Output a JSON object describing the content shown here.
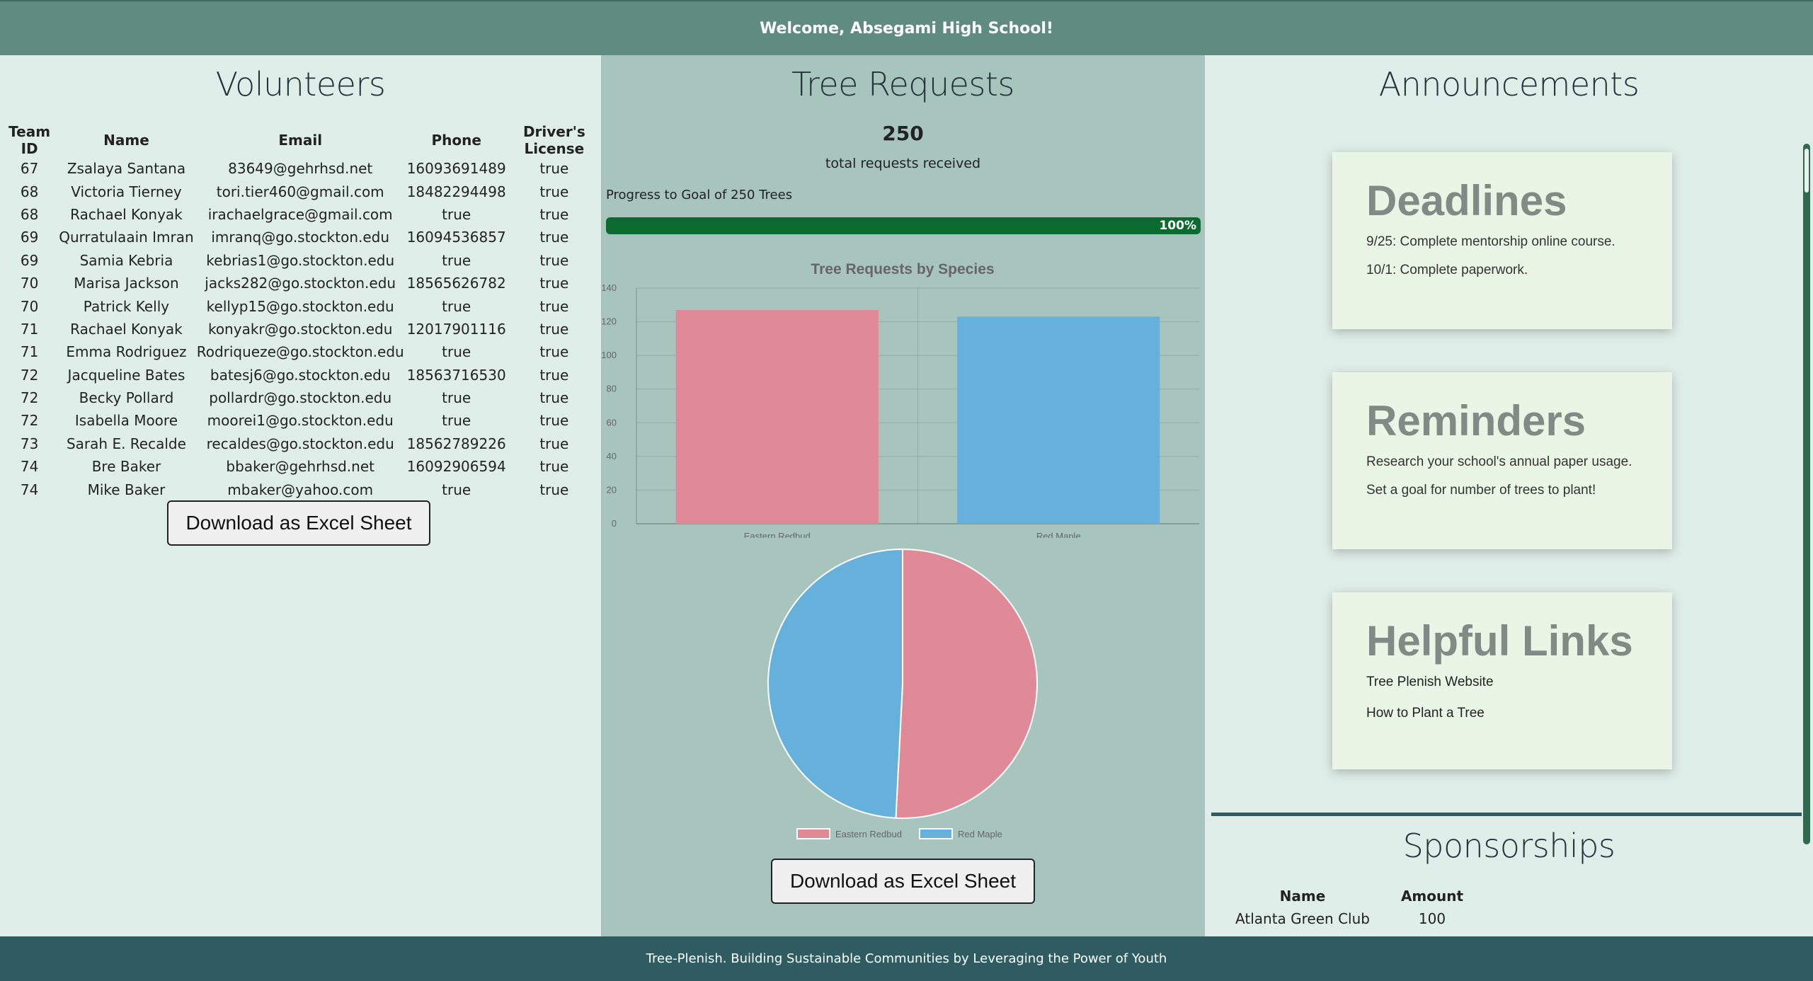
{
  "header": {
    "welcome": "Welcome, Absegami High School!"
  },
  "volunteers": {
    "title": "Volunteers",
    "columns": [
      "Team ID",
      "Name",
      "Email",
      "Phone",
      "Driver's License"
    ],
    "rows": [
      [
        "67",
        "Zsalaya Santana",
        "83649@gehrhsd.net",
        "16093691489",
        "true"
      ],
      [
        "68",
        "Victoria Tierney",
        "tori.tier460@gmail.com",
        "18482294498",
        "true"
      ],
      [
        "68",
        "Rachael Konyak",
        "irachaelgrace@gmail.com",
        "true",
        "true"
      ],
      [
        "69",
        "Qurratulaain Imran",
        "imranq@go.stockton.edu",
        "16094536857",
        "true"
      ],
      [
        "69",
        "Samia Kebria",
        "kebrias1@go.stockton.edu",
        "true",
        "true"
      ],
      [
        "70",
        "Marisa Jackson",
        "jacks282@go.stockton.edu",
        "18565626782",
        "true"
      ],
      [
        "70",
        "Patrick Kelly",
        "kellyp15@go.stockton.edu",
        "true",
        "true"
      ],
      [
        "71",
        "Rachael Konyak",
        "konyakr@go.stockton.edu",
        "12017901116",
        "true"
      ],
      [
        "71",
        "Emma Rodriguez",
        "Rodriqueze@go.stockton.edu",
        "true",
        "true"
      ],
      [
        "72",
        "Jacqueline Bates",
        "batesj6@go.stockton.edu",
        "18563716530",
        "true"
      ],
      [
        "72",
        "Becky Pollard",
        "pollardr@go.stockton.edu",
        "true",
        "true"
      ],
      [
        "72",
        "Isabella Moore",
        "moorei1@go.stockton.edu",
        "true",
        "true"
      ],
      [
        "73",
        "Sarah E. Recalde",
        "recaldes@go.stockton.edu",
        "18562789226",
        "true"
      ],
      [
        "74",
        "Bre Baker",
        "bbaker@gehrhsd.net",
        "16092906594",
        "true"
      ],
      [
        "74",
        "Mike Baker",
        "mbaker@yahoo.com",
        "true",
        "true"
      ]
    ],
    "download_label": "Download as Excel Sheet"
  },
  "tree_requests": {
    "title": "Tree Requests",
    "total": "250",
    "total_label": "total requests received",
    "goal_label": "Progress to Goal of 250 Trees",
    "progress_percent": 100,
    "progress_text": "100%",
    "download_label": "Download as Excel Sheet"
  },
  "chart_data": [
    {
      "type": "bar",
      "title": "Tree Requests by Species",
      "categories": [
        "Eastern Redbud",
        "Red Maple"
      ],
      "values": [
        127,
        123
      ],
      "colors": [
        "#e08a97",
        "#66b0dc"
      ],
      "ylim": [
        0,
        140
      ],
      "yticks": [
        0,
        20,
        40,
        60,
        80,
        100,
        120,
        140
      ],
      "grid": true
    },
    {
      "type": "pie",
      "categories": [
        "Eastern Redbud",
        "Red Maple"
      ],
      "values": [
        127,
        123
      ],
      "colors": [
        "#e08a97",
        "#66b0dc"
      ],
      "legend": "bottom"
    }
  ],
  "announcements": {
    "title": "Announcements",
    "cards": [
      {
        "heading": "Deadlines",
        "lines": [
          "9/25: Complete mentorship online course.",
          "10/1: Complete paperwork."
        ]
      },
      {
        "heading": "Reminders",
        "lines": [
          "Research your school's annual paper usage.",
          "Set a goal for number of trees to plant!"
        ]
      },
      {
        "heading": "Helpful Links",
        "lines": [
          "Tree Plenish Website",
          "How to Plant a Tree"
        ]
      }
    ]
  },
  "sponsorships": {
    "title": "Sponsorships",
    "columns": [
      "Name",
      "Amount"
    ],
    "rows": [
      [
        "Atlanta Green Club",
        "100"
      ]
    ]
  },
  "footer": {
    "text": "Tree-Plenish. Building Sustainable Communities by Leveraging the Power of Youth"
  }
}
